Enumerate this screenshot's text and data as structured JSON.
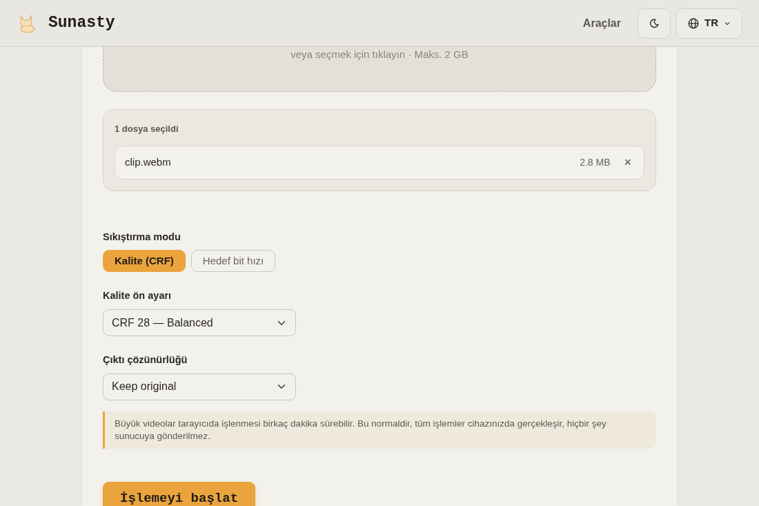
{
  "header": {
    "brand": "Sunasty",
    "nav_link": "Araçlar",
    "language": "TR"
  },
  "dropzone": {
    "hint": "veya seçmek için tıklayın · Maks. 2 GB"
  },
  "selected_files": {
    "title": "1 dosya seçildi",
    "files": [
      {
        "name": "clip.webm",
        "size": "2.8 MB",
        "remove": "×"
      }
    ]
  },
  "compression_mode": {
    "label": "Sıkıştırma modu",
    "options": [
      {
        "label": "Kalite (CRF)",
        "selected": true
      },
      {
        "label": "Hedef bit hızı",
        "selected": false
      }
    ]
  },
  "quality_preset": {
    "label": "Kalite ön ayarı",
    "value": "CRF 28 — Balanced"
  },
  "output_resolution": {
    "label": "Çıktı çözünürlüğü",
    "value": "Keep original"
  },
  "notice": "Büyük videolar tarayıcıda işlenmesi birkaç dakika sürebilir. Bu normaldir, tüm işlemler cihazınızda gerçekleşir, hiçbir şey sunucuya gönderilmez.",
  "start_button": "İşlemeyi başlat"
}
